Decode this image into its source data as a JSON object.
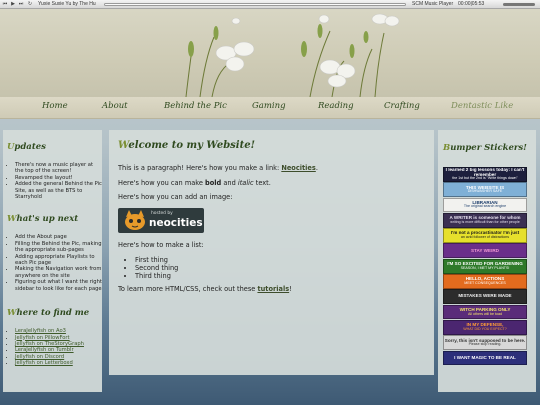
{
  "player": {
    "track": "Yuxie Suxie Yu by The Hu",
    "name": "SCM Music Player",
    "time": "00:00|05:53",
    "icons": [
      "prev-icon",
      "play-icon",
      "next-icon",
      "repeat-icon"
    ]
  },
  "nav": {
    "items": [
      {
        "label": "Home"
      },
      {
        "label": "About"
      },
      {
        "label": "Behind the Pic"
      },
      {
        "label": "Gaming"
      },
      {
        "label": "Reading"
      },
      {
        "label": "Crafting"
      },
      {
        "label": "Dentastic Like"
      }
    ]
  },
  "updates": {
    "title_cap": "U",
    "title_rest": "pdates",
    "items": [
      "There's now a music player at the top of the screen!",
      "Revamped the layout!",
      "Added the general Behind the Pic Site, as well as the BTS to Starryhold"
    ]
  },
  "whats_up_next": {
    "title_cap": "W",
    "title_rest": "hat's up next",
    "items": [
      "Add the About page",
      "Filling the Behind the Pic, making the appropriate sub-pages",
      "Adding appropriate Playlists to each Pic page",
      "Making the Navigation work from anywhere on the site",
      "Figuring out what I want the right sidebar to look like for each page"
    ]
  },
  "where_to_find_me": {
    "title_cap": "W",
    "title_rest": "here to find me",
    "links": [
      "LeraJellyfish on Ao3",
      "Jellyfish on PillowFort",
      "Jellyfish on TheStoryGraph",
      "LeraJellyfish on Tumblr",
      "Jellyfish on Discord",
      "Jellyfish on Letterboxd"
    ]
  },
  "main": {
    "title_cap": "W",
    "title_rest": "elcome to my Website!",
    "para1_text": "This is a paragraph! Here's how you make a link: ",
    "para1_link": "Neocities",
    "para1_end": ".",
    "para2_a": "Here's how you can make ",
    "para2_bold": "bold",
    "para2_b": " and ",
    "para2_italic": "italic",
    "para2_c": " text.",
    "para3": "Here's how you can add an image:",
    "badge_hosted": "hosted by",
    "badge_brand": "neocities",
    "para4": "Here's how to make a list:",
    "list": [
      "First thing",
      "Second thing",
      "Third thing"
    ],
    "para5_text": "To learn more HTML/CSS, check out these ",
    "para5_link": "tutorials",
    "para5_end": "!"
  },
  "bumper": {
    "title_cap": "B",
    "title_rest": "umper Stickers!",
    "stickers": [
      {
        "l1": "I learned 2 big lessons today: I can't remember",
        "l2": "the 1st but the 2nd is \"Write things down\"",
        "bg": "#1d1f3d",
        "fg": "#ffffff"
      },
      {
        "l1": "THIS WEBSITE IS",
        "l2": "DISHWASHER SAFE",
        "bg": "#7fb0d6",
        "fg": "#ffffff"
      },
      {
        "l1": "LIBRARIAN",
        "l2": "The original search engine",
        "bg": "#f2f2ef",
        "fg": "#1b3c6a"
      },
      {
        "l1": "A WRITER is someone for whom",
        "l2": "writing is more difficult than for other people",
        "bg": "#3a2f52",
        "fg": "#e7e1f0"
      },
      {
        "l1": "I'm not a procrastinator I'm just",
        "l2": "an avid follower of distractions",
        "bg": "#e6e02c",
        "fg": "#1a1a1a"
      },
      {
        "l1": "STAY WEIRD",
        "l2": "",
        "bg": "#6a2e8a",
        "fg": "#f29ad5"
      },
      {
        "l1": "I'M SO EXCITED FOR GARDENING",
        "l2": "SEASON, I MET MY PLANTS!",
        "bg": "#2e7a2a",
        "fg": "#ffffff"
      },
      {
        "l1": "HELLO, ACTIONS",
        "l2": "MEET CONSEQUENCES",
        "bg": "#e26b1e",
        "fg": "#ffffff"
      },
      {
        "l1": "MISTAKES WERE MADE",
        "l2": "",
        "bg": "#2c2c2c",
        "fg": "#f2f2f2"
      },
      {
        "l1": "WITCH PARKING ONLY",
        "l2": "All others will be toad",
        "bg": "#5a2c7a",
        "fg": "#f5e46a"
      },
      {
        "l1": "IN MY DEFENSE,",
        "l2": "WHAT DID YOU EXPECT?",
        "bg": "#4b2670",
        "fg": "#ff9d36"
      },
      {
        "l1": "Sorry, this isn't supposed to be here.",
        "l2": "Please stop reading.",
        "bg": "#d8d8d8",
        "fg": "#333333"
      },
      {
        "l1": "I WANT MAGIC TO BE REAL",
        "l2": "",
        "bg": "#2c2f7a",
        "fg": "#ffffff"
      }
    ]
  }
}
